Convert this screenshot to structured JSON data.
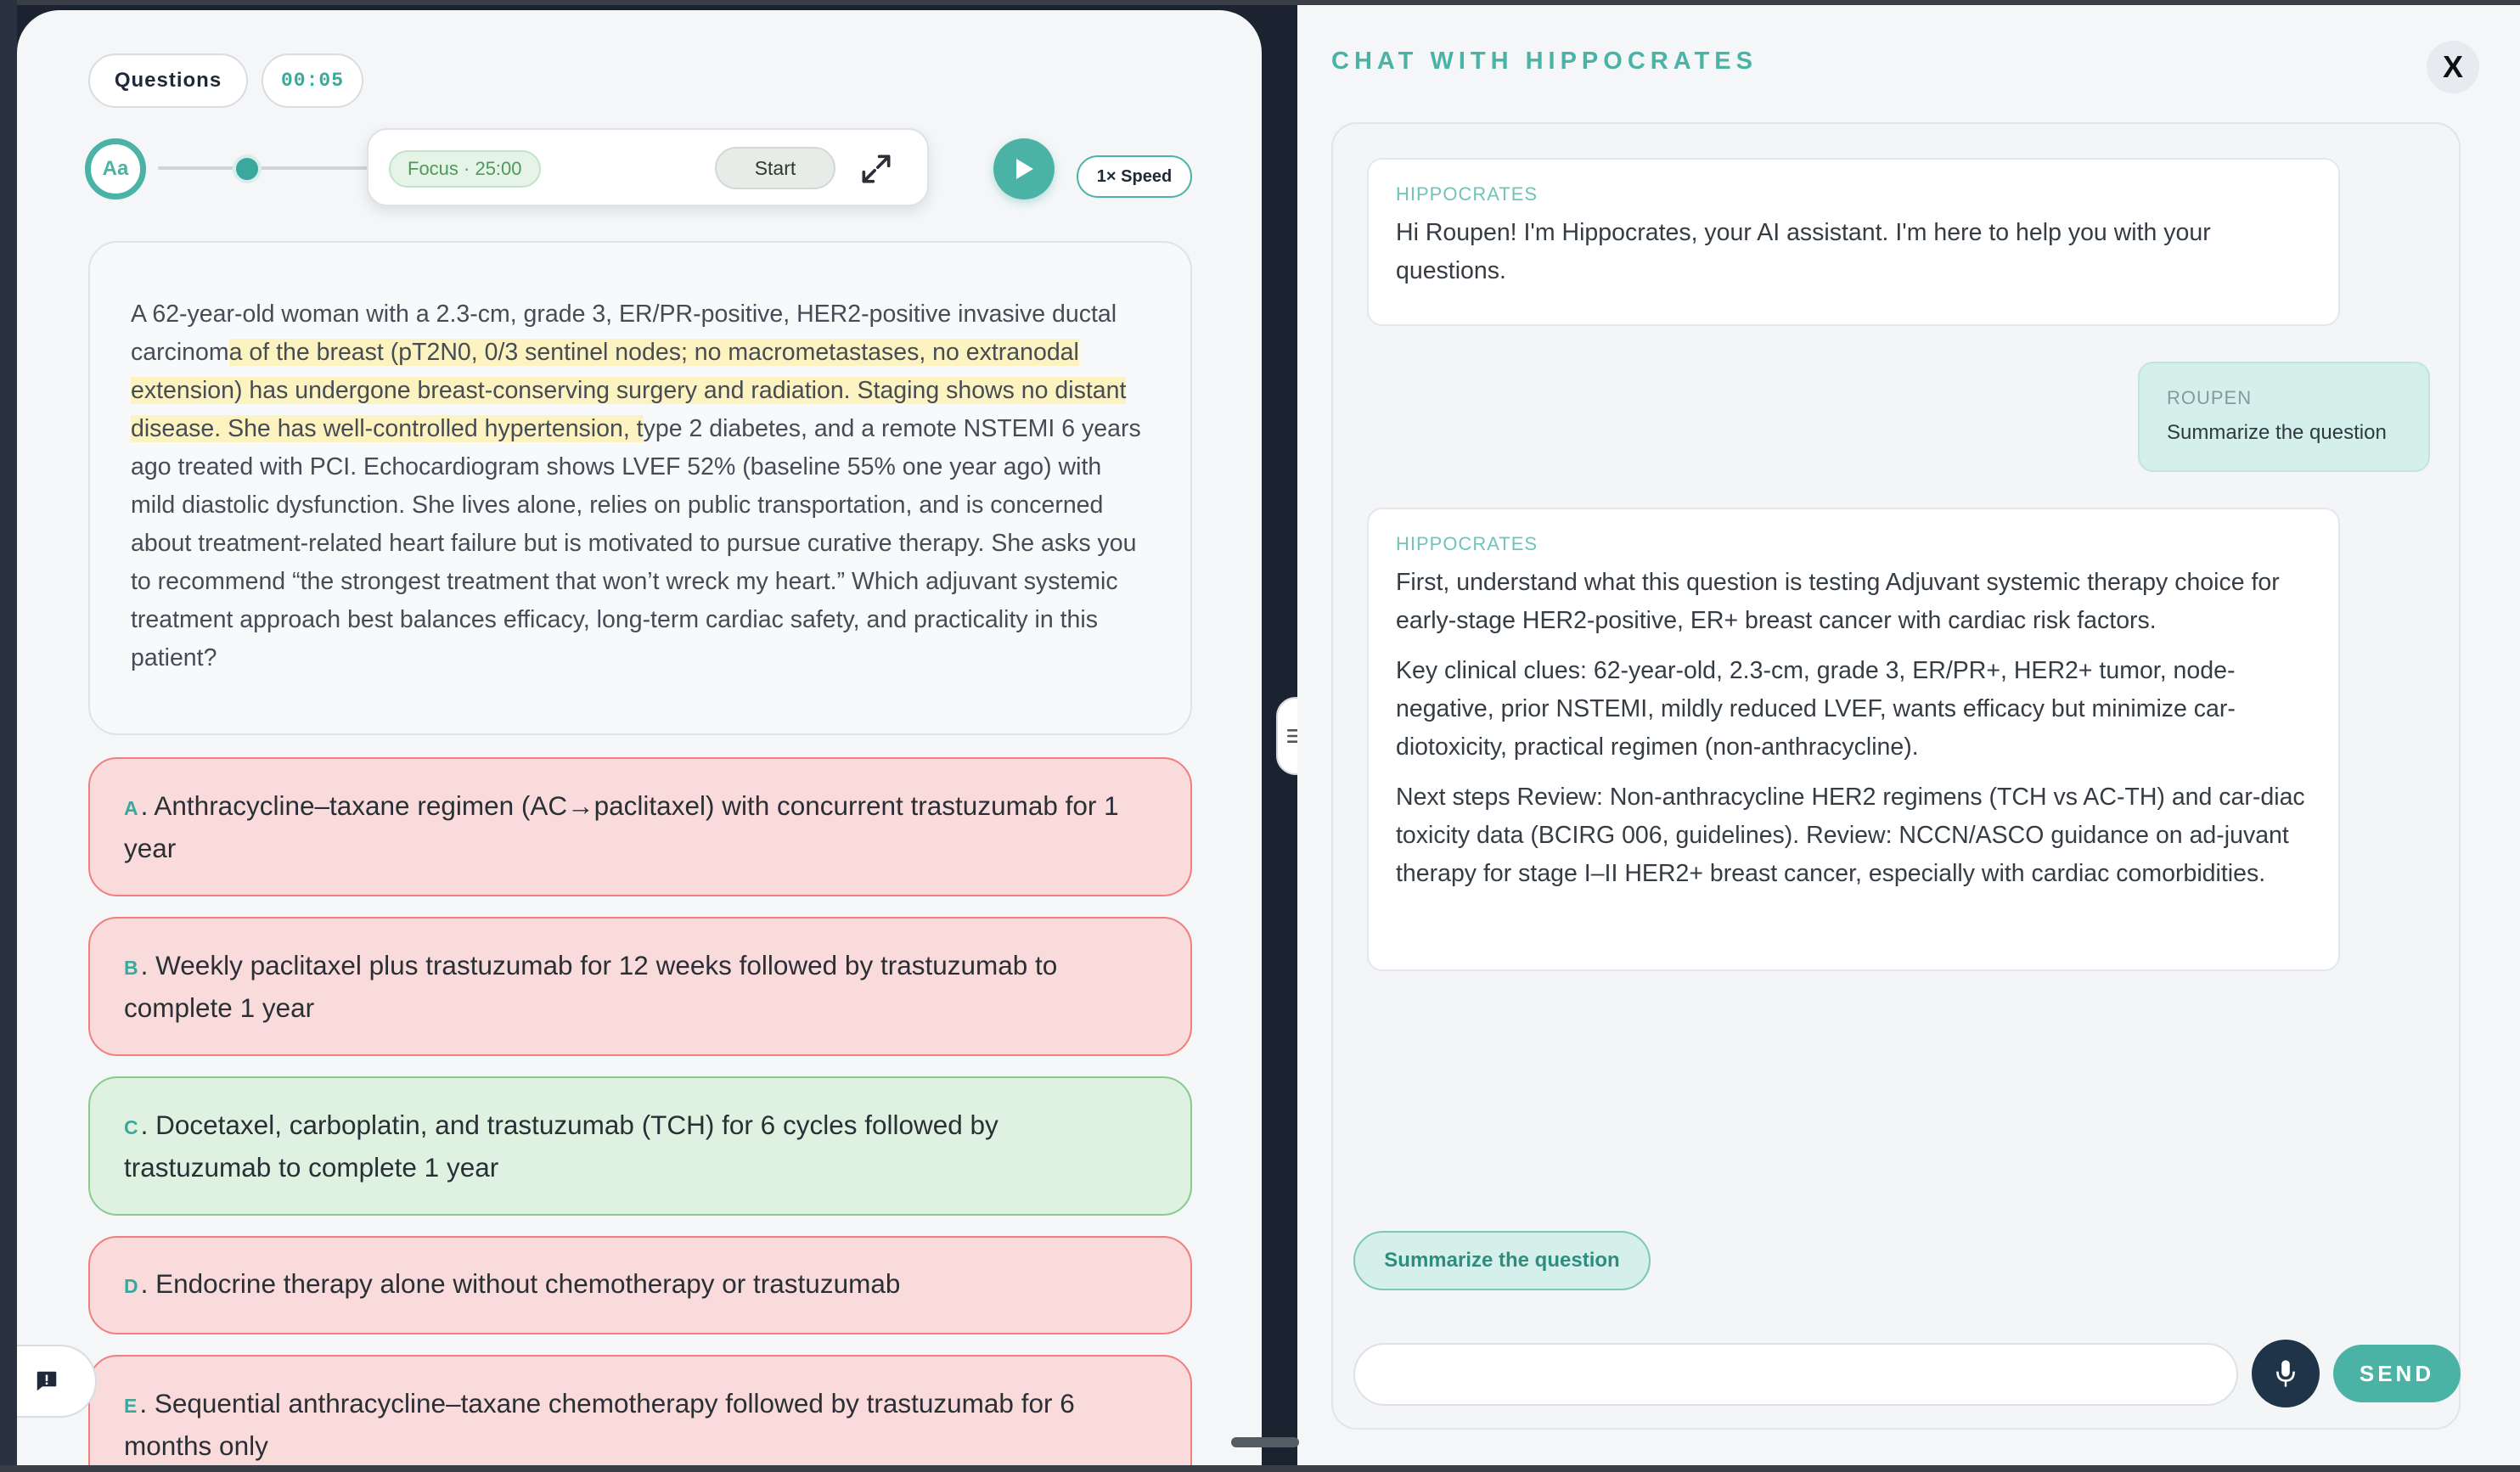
{
  "toolbar": {
    "questions_label": "Questions",
    "timer": "00:05",
    "font_toggle": "Aa",
    "focus_label": "Focus · 25:00",
    "start_label": "Start",
    "speed_label": "1× Speed"
  },
  "question": {
    "stem_before": "A 62-year-old woman with a 2.3-cm, grade 3, ER/PR-positive, HER2-positive invasive ductal carcinom",
    "stem_highlight": "a of the breast (pT2N0, 0/3 sentinel nodes; no macrometastases, no extranodal extension) has undergone breast-conserving surgery and radiation. Staging shows no distant disease. She has well-controlled hypertension, t",
    "stem_after": "ype 2 diabetes, and a remote NSTEMI 6 years ago treated with PCI. Echocardiogram shows LVEF 52% (baseline 55% one year ago) with mild diastolic dysfunction. She lives alone, relies on public transportation, and is concerned about treatment-related heart failure but is motivated to pursue curative therapy. She asks you to recommend “the strongest treatment that won’t wreck my heart.” Which adjuvant systemic treatment approach best balances efficacy, long-term cardiac safety, and practicality in this patient?",
    "options": [
      {
        "letter": "A",
        "text": ". Anthracycline–taxane regimen (AC→paclitaxel) with concurrent trastuzumab for 1 year",
        "status": "wrong"
      },
      {
        "letter": "B",
        "text": ". Weekly paclitaxel plus trastuzumab for 12 weeks followed by trastuzumab to complete 1 year",
        "status": "wrong"
      },
      {
        "letter": "C",
        "text": ". Docetaxel, carboplatin, and trastuzumab (TCH) for 6 cycles followed by trastuzumab to complete 1 year",
        "status": "correct"
      },
      {
        "letter": "D",
        "text": ". Endocrine therapy alone without chemotherapy or trastuzumab",
        "status": "wrong"
      },
      {
        "letter": "E",
        "text": ". Sequential anthracycline–taxane chemotherapy followed by trastuzumab for 6 months only",
        "status": "wrong"
      }
    ]
  },
  "chat": {
    "title": "CHAT WITH HIPPOCRATES",
    "close_label": "X",
    "messages": [
      {
        "sender": "HIPPOCRATES",
        "paragraphs": [
          "Hi Roupen! I'm Hippocrates, your AI assistant. I'm here to help you with your questions."
        ]
      },
      {
        "sender": "ROUPEN",
        "paragraphs": [
          "Summarize the question"
        ]
      },
      {
        "sender": "HIPPOCRATES",
        "paragraphs": [
          "First, understand what this question is testing Adjuvant systemic therapy choice for early-stage HER2-positive, ER+ breast cancer with cardiac risk factors.",
          "Key clinical clues: 62-year-old, 2.3-cm, grade 3, ER/PR+, HER2+ tumor, node-negative, prior NSTEMI, mildly reduced LVEF, wants efficacy but minimize car-diotoxicity, practical regimen (non-anthracycline).",
          "Next steps Review: Non-anthracycline HER2 regimens (TCH vs AC-TH) and car-diac toxicity data (BCIRG 006, guidelines). Review: NCCN/ASCO guidance on ad-juvant therapy for stage I–II HER2+ breast cancer, especially with cardiac comorbidities."
        ]
      }
    ],
    "suggestion": "Summarize the question",
    "input_value": "",
    "send_label": "SEND"
  },
  "colors": {
    "accent": "#4ab3a6",
    "wrong_bg": "#fadbdb",
    "wrong_border": "#f07f7f",
    "correct_bg": "#dff1e0",
    "correct_border": "#86cc8f",
    "highlight": "#fdf3c0"
  },
  "icons": {
    "expand": "expand-arrows-icon",
    "play": "play-icon",
    "menu": "hamburger-icon",
    "mic": "microphone-icon",
    "report": "report-icon"
  }
}
